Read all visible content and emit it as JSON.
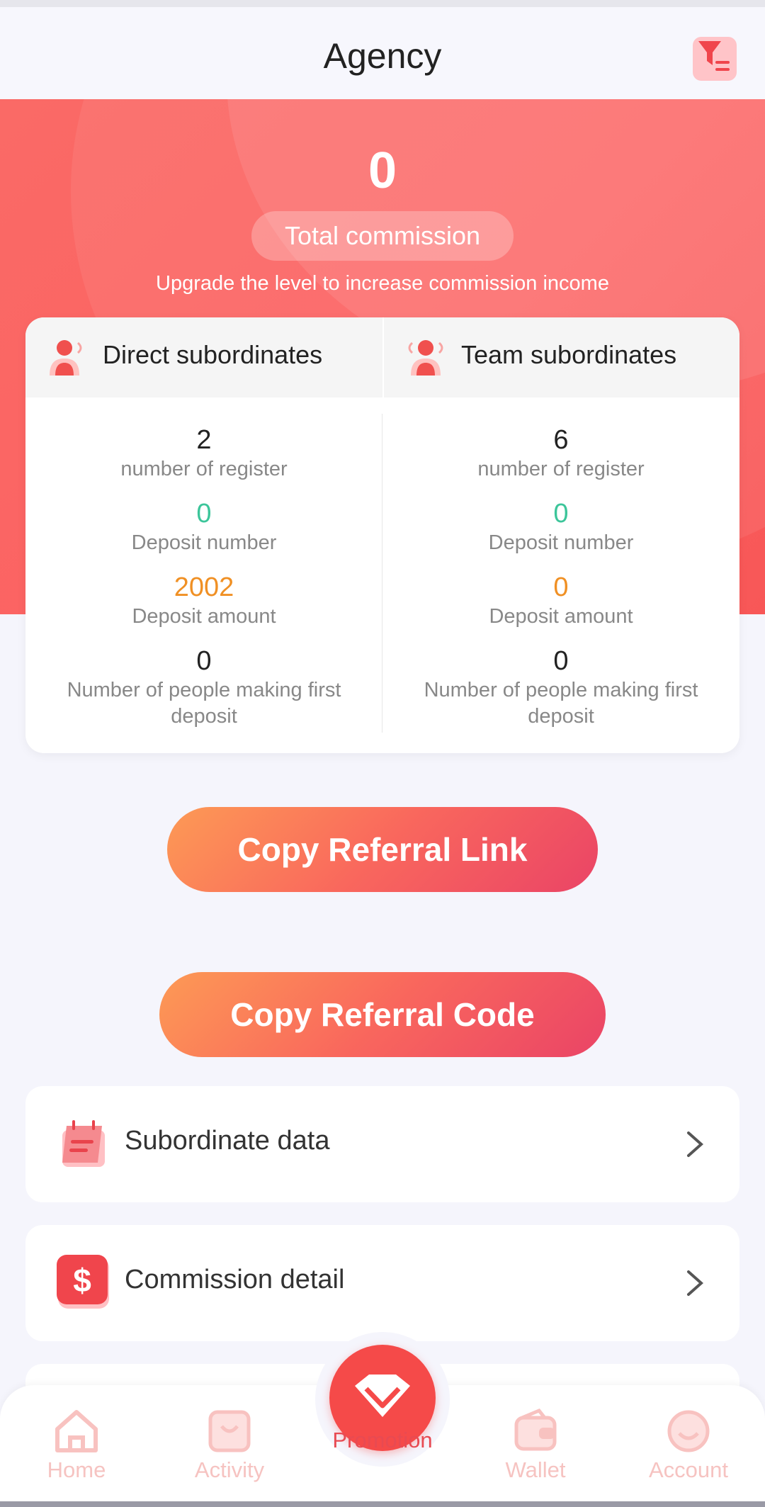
{
  "header": {
    "title": "Agency"
  },
  "commission": {
    "amount": "0",
    "label": "Total commission",
    "upgrade_text": "Upgrade the level to increase commission income"
  },
  "stats": {
    "direct": {
      "title": "Direct subordinates",
      "register_value": "2",
      "register_label": "number of register",
      "deposit_number_value": "0",
      "deposit_number_label": "Deposit number",
      "deposit_amount_value": "2002",
      "deposit_amount_label": "Deposit amount",
      "first_deposit_value": "0",
      "first_deposit_label": "Number of people making first deposit"
    },
    "team": {
      "title": "Team subordinates",
      "register_value": "6",
      "register_label": "number of register",
      "deposit_number_value": "0",
      "deposit_number_label": "Deposit number",
      "deposit_amount_value": "0",
      "deposit_amount_label": "Deposit amount",
      "first_deposit_value": "0",
      "first_deposit_label": "Number of people making first deposit"
    }
  },
  "buttons": {
    "copy_link": "Copy Referral Link",
    "copy_code": "Copy Referral Code"
  },
  "menu": {
    "subordinate": {
      "label": "Subordinate data",
      "icon": "calendar-icon"
    },
    "commission": {
      "label": "Commission detail",
      "icon": "dollar-icon"
    }
  },
  "nav": {
    "home": "Home",
    "activity": "Activity",
    "promotion": "Promotion",
    "wallet": "Wallet",
    "account": "Account"
  },
  "colors": {
    "brand_red": "#f54a49",
    "deposit_green": "#3cc59a",
    "deposit_orange": "#f09024",
    "nav_inactive": "#f6c3c1"
  }
}
